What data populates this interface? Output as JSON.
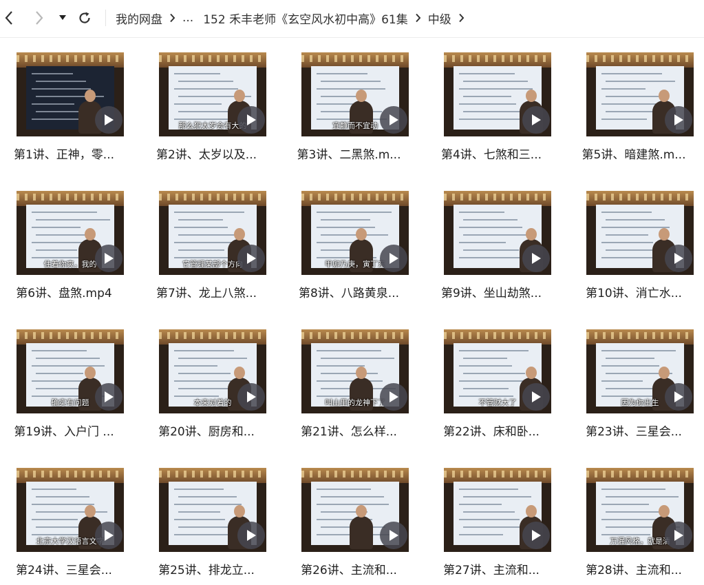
{
  "nav": {
    "back_icon": "chevron-left-icon",
    "forward_icon": "chevron-right-icon",
    "history_icon": "caret-down-icon",
    "refresh_icon": "refresh-icon"
  },
  "breadcrumb": {
    "root": "我的网盘",
    "ellipsis": "...",
    "folder": "152 禾丰老师《玄空风水初中高》61集",
    "current": "中级"
  },
  "items": [
    {
      "title": "第1讲、正神，零...",
      "screen": "dark",
      "subtitle": ""
    },
    {
      "title": "第2讲、太岁以及...",
      "screen": "light",
      "subtitle": "那么犯太岁会有大的"
    },
    {
      "title": "第3讲、二黑煞.m...",
      "screen": "light",
      "subtitle": "宜静而不宜动"
    },
    {
      "title": "第4讲、七煞和三...",
      "screen": "light",
      "subtitle": ""
    },
    {
      "title": "第5讲、暗建煞.m...",
      "screen": "light",
      "subtitle": ""
    },
    {
      "title": "第6讲、盘煞.mp4",
      "screen": "light",
      "subtitle": "住着你爽，我的"
    },
    {
      "title": "第7讲、龙上八煞...",
      "screen": "light",
      "subtitle": "它管理某部个方向"
    },
    {
      "title": "第8讲、八路黄泉...",
      "screen": "light",
      "subtitle": "甲卯乃庚，寅丁东"
    },
    {
      "title": "第9讲、坐山劫煞...",
      "screen": "light",
      "subtitle": ""
    },
    {
      "title": "第10讲、消亡水...",
      "screen": "light",
      "subtitle": ""
    },
    {
      "title": "第19讲、入户门 ...",
      "screen": "light",
      "subtitle": "确实有问题"
    },
    {
      "title": "第20讲、厨房和...",
      "screen": "light",
      "subtitle": "本来对着的"
    },
    {
      "title": "第21讲、怎么样...",
      "screen": "light",
      "subtitle": "叫山里的龙神下了"
    },
    {
      "title": "第22讲、床和卧...",
      "screen": "light",
      "subtitle": "不管财大了"
    },
    {
      "title": "第23讲、三星会...",
      "screen": "light",
      "subtitle": "因为你出生"
    },
    {
      "title": "第24讲、三星会...",
      "screen": "light",
      "subtitle": "北京大学汉语言文字"
    },
    {
      "title": "第25讲、排龙立...",
      "screen": "light",
      "subtitle": ""
    },
    {
      "title": "第26讲、主流和...",
      "screen": "light",
      "subtitle": ""
    },
    {
      "title": "第27讲、主流和...",
      "screen": "light",
      "subtitle": ""
    },
    {
      "title": "第28讲、主流和...",
      "screen": "light",
      "subtitle": "万漏风格，就是清"
    }
  ],
  "play_icon": "play-icon"
}
